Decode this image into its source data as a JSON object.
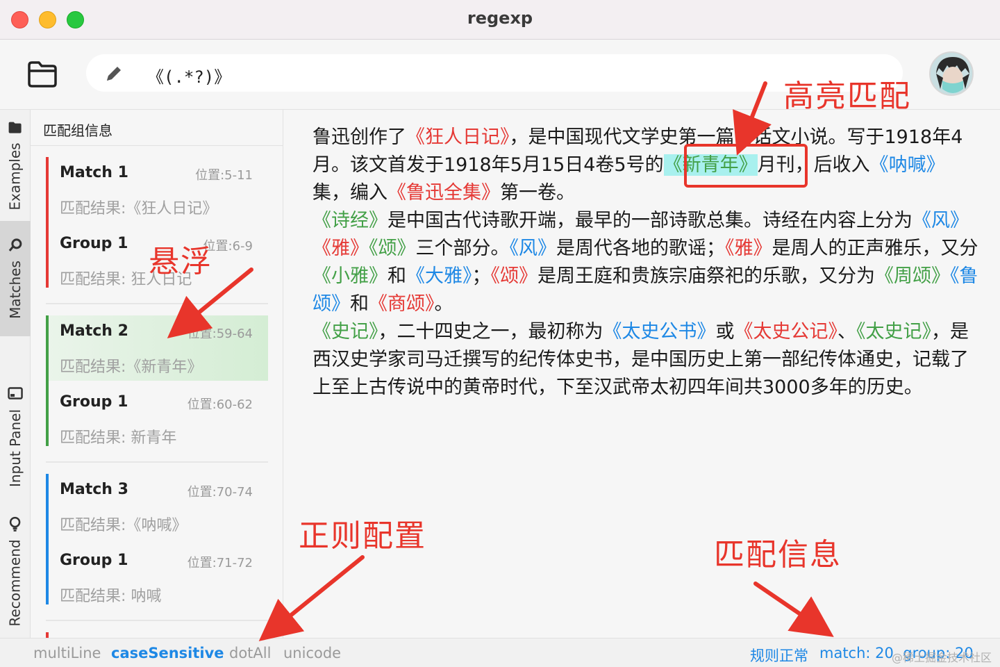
{
  "window": {
    "title": "regexp"
  },
  "toolbar": {
    "regex": "《(.*?)》"
  },
  "tabs": [
    {
      "label": "Examples",
      "icon": "folder-icon"
    },
    {
      "label": "Matches",
      "icon": "match-icon"
    },
    {
      "label": "Input Panel",
      "icon": "panel-icon"
    },
    {
      "label": "Recommend",
      "icon": "bulb-icon"
    }
  ],
  "match_panel": {
    "header": "匹配组信息",
    "matches": [
      {
        "title": "Match  1",
        "pos": "位置:5-11",
        "result": "匹配结果:《狂人日记》",
        "group_title": "Group  1",
        "group_pos": "位置:6-9",
        "group_result": "匹配结果: 狂人日记",
        "color": "#e53935"
      },
      {
        "title": "Match  2",
        "pos": "位置:59-64",
        "result": "匹配结果:《新青年》",
        "group_title": "Group  1",
        "group_pos": "位置:60-62",
        "group_result": "匹配结果: 新青年",
        "color": "#43a047"
      },
      {
        "title": "Match  3",
        "pos": "位置:70-74",
        "result": "匹配结果:《呐喊》",
        "group_title": "Group  1",
        "group_pos": "位置:71-72",
        "group_result": "匹配结果: 呐喊",
        "color": "#1e88e5"
      }
    ]
  },
  "text": {
    "p1": [
      {
        "t": "鲁迅创作了",
        "c": ""
      },
      {
        "t": "《狂人日记》",
        "c": "red"
      },
      {
        "t": "，是中国现代文学史第一篇白话文小说。写于1918年4月。该文首发于1918年5月15日4卷5号的",
        "c": ""
      },
      {
        "t": "《新青年》",
        "c": "green-hover"
      },
      {
        "t": "月刊，后收入",
        "c": ""
      },
      {
        "t": "《呐喊》",
        "c": "blue"
      },
      {
        "t": "集，编入",
        "c": ""
      },
      {
        "t": "《鲁迅全集》",
        "c": "red"
      },
      {
        "t": "第一卷。",
        "c": ""
      }
    ],
    "p2": [
      {
        "t": "《诗经》",
        "c": "green"
      },
      {
        "t": "是中国古代诗歌开端，最早的一部诗歌总集。诗经在内容上分为",
        "c": ""
      },
      {
        "t": "《风》",
        "c": "blue"
      },
      {
        "t": "《雅》",
        "c": "red"
      },
      {
        "t": "《颂》",
        "c": "green"
      },
      {
        "t": "三个部分。",
        "c": ""
      },
      {
        "t": "《风》",
        "c": "blue"
      },
      {
        "t": "是周代各地的歌谣；",
        "c": ""
      },
      {
        "t": "《雅》",
        "c": "red"
      },
      {
        "t": "是周人的正声雅乐，又分",
        "c": ""
      },
      {
        "t": "《小雅》",
        "c": "green"
      },
      {
        "t": "和",
        "c": ""
      },
      {
        "t": "《大雅》",
        "c": "blue"
      },
      {
        "t": "；",
        "c": ""
      },
      {
        "t": "《颂》",
        "c": "red"
      },
      {
        "t": "是周王庭和贵族宗庙祭祀的乐歌，又分为",
        "c": ""
      },
      {
        "t": "《周颂》",
        "c": "green"
      },
      {
        "t": "《鲁颂》",
        "c": "blue"
      },
      {
        "t": "和",
        "c": ""
      },
      {
        "t": "《商颂》",
        "c": "red"
      },
      {
        "t": "。",
        "c": ""
      }
    ],
    "p3": [
      {
        "t": "《史记》",
        "c": "green"
      },
      {
        "t": "，二十四史之一，最初称为",
        "c": ""
      },
      {
        "t": "《太史公书》",
        "c": "blue"
      },
      {
        "t": "或",
        "c": ""
      },
      {
        "t": "《太史公记》",
        "c": "red"
      },
      {
        "t": "、",
        "c": ""
      },
      {
        "t": "《太史记》",
        "c": "green"
      },
      {
        "t": "，是西汉史学家司马迁撰写的纪传体史书，是中国历史上第一部纪传体通史，记载了上至上古传说中的黄帝时代，下至汉武帝太初四年间共3000多年的历史。",
        "c": ""
      }
    ]
  },
  "status": {
    "options": [
      {
        "label": "multiLine",
        "on": false
      },
      {
        "label": "caseSensitive",
        "on": true
      },
      {
        "label": "dotAll",
        "on": false
      },
      {
        "label": "unicode",
        "on": false
      }
    ],
    "rule_state": "规则正常",
    "counts": "match: 20  group: 20",
    "watermark": "@稀土掘金技术社区"
  },
  "annotations": {
    "highlight": "高亮匹配",
    "hover": "悬浮",
    "regex_config": "正则配置",
    "match_info": "匹配信息"
  },
  "colors": {
    "red": "#e53935",
    "green": "#43a047",
    "blue": "#1e88e5",
    "annotation": "#e8352b",
    "hover": "#a8f0ee"
  }
}
